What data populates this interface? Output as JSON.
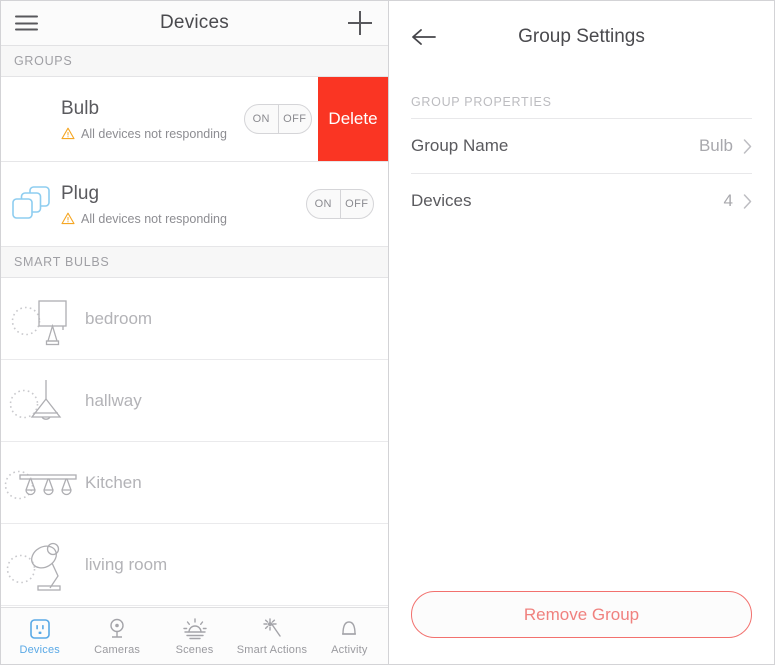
{
  "left": {
    "nav": {
      "menu_icon": "hamburger-icon",
      "title": "Devices",
      "add_icon": "plus-icon"
    },
    "sections": [
      {
        "header": "GROUPS",
        "groups": [
          {
            "name": "Bulb",
            "icon": "none",
            "status": "All devices not responding",
            "warn_icon": "warning-triangle-icon",
            "toggle": {
              "on": "ON",
              "off": "OFF"
            },
            "swipe_action": "Delete"
          },
          {
            "name": "Plug",
            "icon": "stacked-squares-icon",
            "status": "All devices not responding",
            "warn_icon": "warning-triangle-icon",
            "toggle": {
              "on": "ON",
              "off": "OFF"
            },
            "swipe_action": null
          }
        ]
      },
      {
        "header": "SMART BULBS",
        "bulbs": [
          {
            "name": "bedroom",
            "icon": "table-lamp-icon",
            "state": "off"
          },
          {
            "name": "hallway",
            "icon": "pendant-lamp-icon",
            "state": "off"
          },
          {
            "name": "Kitchen",
            "icon": "track-lights-icon",
            "state": "off"
          },
          {
            "name": "living room",
            "icon": "desk-lamp-icon",
            "state": "off"
          }
        ]
      }
    ],
    "tabs": [
      {
        "label": "Devices",
        "icon": "outlet-icon",
        "active": true
      },
      {
        "label": "Cameras",
        "icon": "camera-icon",
        "active": false
      },
      {
        "label": "Scenes",
        "icon": "sunrise-icon",
        "active": false
      },
      {
        "label": "Smart Actions",
        "icon": "magic-wand-icon",
        "active": false
      },
      {
        "label": "Activity",
        "icon": "bell-icon",
        "active": false
      }
    ]
  },
  "right": {
    "nav": {
      "back_icon": "back-arrow-icon",
      "title": "Group Settings"
    },
    "properties_header": "GROUP PROPERTIES",
    "rows": [
      {
        "label": "Group Name",
        "value": "Bulb",
        "chevron": "chevron-right-icon"
      },
      {
        "label": "Devices",
        "value": "4",
        "chevron": "chevron-right-icon"
      }
    ],
    "remove_button": "Remove Group"
  },
  "colors": {
    "delete_red": "#fa3523",
    "accent_blue": "#5aa9e6",
    "warning_orange": "#f5a623",
    "remove_border": "#f2716e"
  }
}
